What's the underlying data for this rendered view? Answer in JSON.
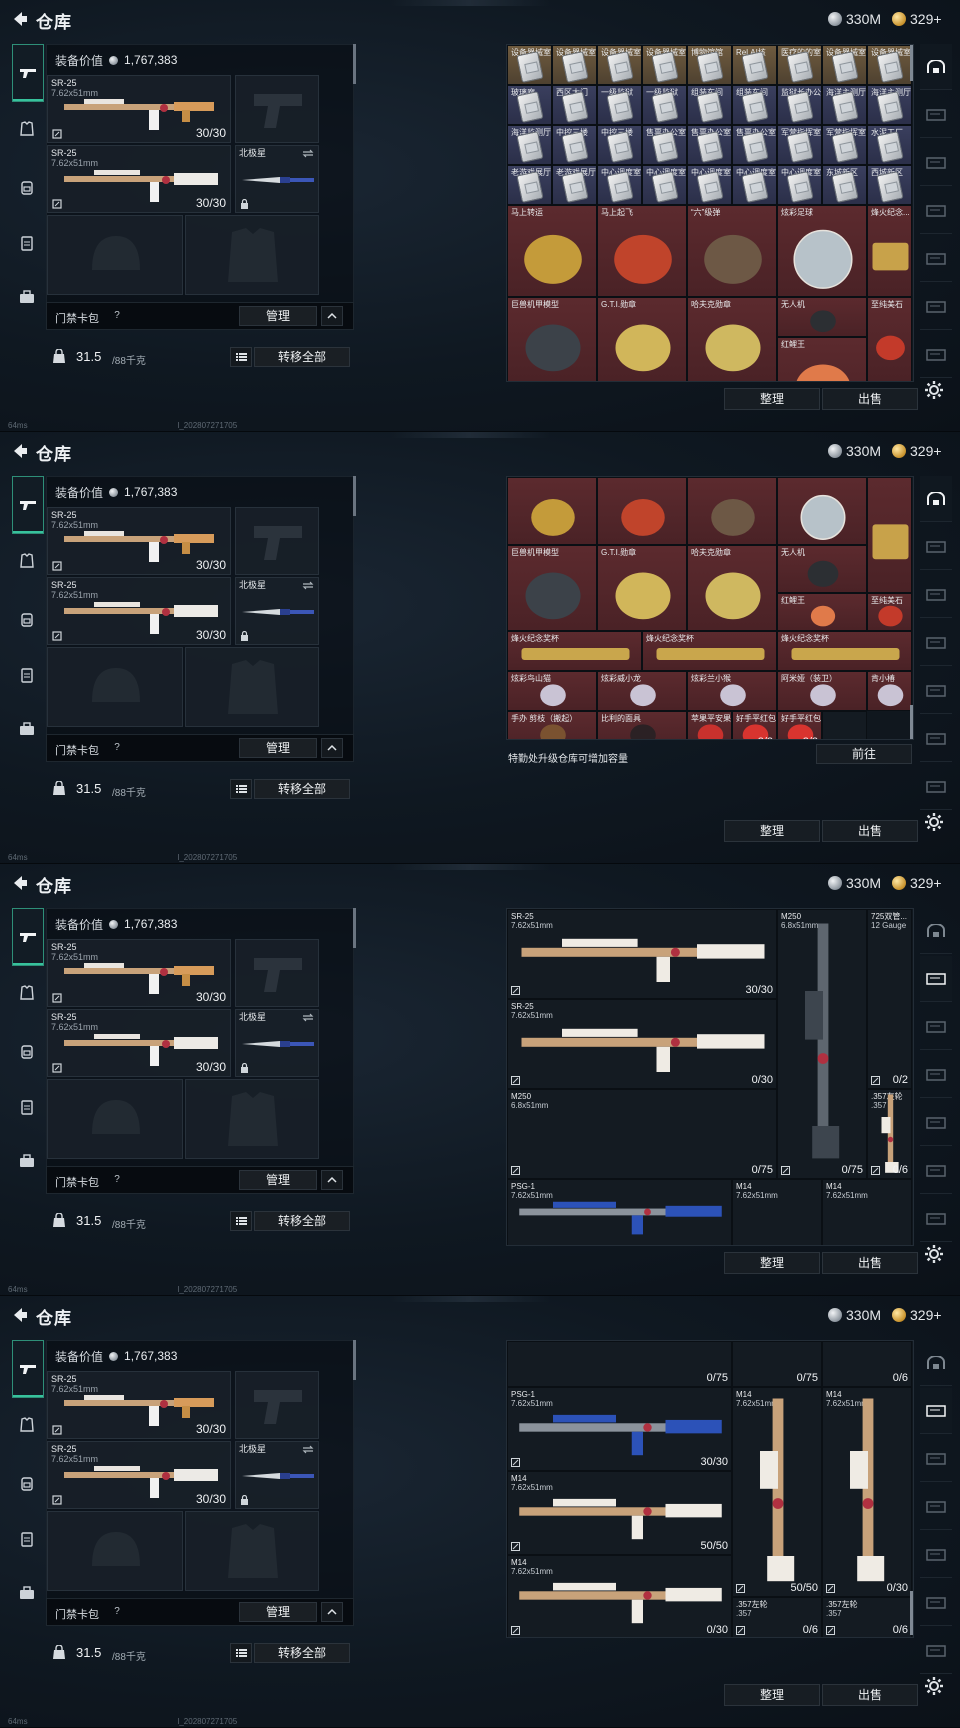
{
  "topbar": {
    "title": "仓库",
    "currency_silver": "330M",
    "currency_gold": "329+"
  },
  "equip": {
    "value_label": "装备价值",
    "value": "1,767,383",
    "slots": [
      {
        "name": "SR-25",
        "caliber": "7.62x51mm",
        "ammo": "30/30"
      },
      {
        "name": "SR-25",
        "caliber": "7.62x51mm",
        "ammo": "30/30"
      }
    ],
    "melee_name": "北极星",
    "keycard_label": "门禁卡包",
    "help": "?",
    "manage": "管理",
    "weight": "31.5",
    "weight_max": "/88千克",
    "move_all": "转移全部"
  },
  "status": {
    "ping": "64ms",
    "uid": "l_202807271705"
  },
  "storage": {
    "sort": "整理",
    "sell": "出售",
    "upgrade_hint": "特勤处升级仓库可增加容量",
    "goto": "前往",
    "p1": {
      "row1": [
        "设备器械室",
        "设备器械室",
        "设备器械室",
        "设备器械室",
        "博物馆馆",
        "Rel.AI核",
        "医疗的的室",
        "设备器械室",
        "设备器械室"
      ],
      "row2": [
        "玻璃廊",
        "西区大门",
        "一级监狱",
        "一级监狱",
        "组装车间",
        "组装车间",
        "监狱长办公",
        "海洋主测厅",
        "海洋主测厅"
      ],
      "row3": [
        "海洋监测厅",
        "中控三楼",
        "中控三楼",
        "售票办公室",
        "售票办公室",
        "售票办公室",
        "军营指挥室",
        "军营指挥室",
        "水泥工厂"
      ],
      "row4": [
        "老游戏展厅",
        "老游戏展厅",
        "中心调度室",
        "中心调度室",
        "中心调度室",
        "中心调度室",
        "中心调度室",
        "东城新区",
        "西城新区"
      ],
      "row5": [
        "马上转运",
        "马上起飞",
        "“六”级弹",
        "炫彩足球",
        "烽火纪念..."
      ],
      "row6": [
        "巨兽机甲模型",
        "G.T.I.勋章",
        "哈夫克勋章",
        "无人机",
        "红鲤王",
        "至纯美石"
      ]
    },
    "p2": {
      "row1": [
        "巨兽机甲模型",
        "G.T.I.勋章",
        "哈夫克勋章",
        "无人机"
      ],
      "row2": [
        "红鲤王",
        "至纯美石"
      ],
      "row3": [
        "烽火纪念奖杯",
        "烽火纪念奖杯",
        "烽火纪念奖杯"
      ],
      "row4": [
        "炫彩鸟山猫",
        "炫彩威小龙",
        "炫彩兰小猴",
        "阿米娅（装卫）",
        "肯小椿"
      ],
      "row5": [
        "手办 剪枝（搬起）",
        "比利的面具",
        "苹果平安果",
        "好手平红包",
        "好手平红包"
      ],
      "stack": "3/3"
    },
    "p3": {
      "guns": [
        {
          "name": "SR-25",
          "caliber": "7.62x51mm",
          "ammo": "30/30"
        },
        {
          "name": "SR-25",
          "caliber": "7.62x51mm",
          "ammo": "0/30"
        },
        {
          "name": "M250",
          "caliber": "6.8x51mm",
          "ammo": "0/75"
        },
        {
          "name": "M250",
          "caliber": "6.8x51mm",
          "ammo": "0/75"
        },
        {
          "name": "725双管...",
          "caliber": "12 Gauge",
          "ammo": "0/2"
        },
        {
          "name": ".357左轮",
          "caliber": ".357",
          "ammo": "0/6"
        },
        {
          "name": "PSG-1",
          "caliber": "7.62x51mm",
          "ammo": ""
        },
        {
          "name": "M14",
          "caliber": "7.62x51mm",
          "ammo": ""
        },
        {
          "name": "M14",
          "caliber": "7.62x51mm",
          "ammo": ""
        }
      ]
    },
    "p4": {
      "guns": [
        {
          "name": "PSG-1",
          "caliber": "7.62x51mm",
          "ammo": "30/30"
        },
        {
          "name": "M14",
          "caliber": "7.62x51mm",
          "ammo": "50/50"
        },
        {
          "name": "M14",
          "caliber": "7.62x51mm",
          "ammo": "50/50"
        },
        {
          "name": "M14",
          "caliber": "7.62x51mm",
          "ammo": "0/30"
        },
        {
          "name": "M14",
          "caliber": "7.62x51mm",
          "ammo": "0/30"
        },
        {
          "name": ".357左轮",
          "caliber": ".357",
          "ammo": "0/6"
        },
        {
          "name": ".357左轮",
          "caliber": ".357",
          "ammo": "0/6"
        }
      ],
      "top_counts": [
        "0/75",
        "0/75",
        "0/6"
      ]
    }
  },
  "icons": {
    "back": "back-arrow-icon",
    "rifle": "rifle-icon",
    "armor": "armor-icon",
    "backpack": "backpack-icon",
    "vest": "vest-icon",
    "briefcase": "briefcase-icon",
    "gear": "gear-icon",
    "lock": "lock-icon",
    "swap": "swap-icon"
  },
  "colors": {
    "accent": "#37c29c",
    "collectible_bg": "#5c2a2e",
    "keycard_tan": "#6f5b3f",
    "keycard_blue": "#3a3f5e"
  }
}
